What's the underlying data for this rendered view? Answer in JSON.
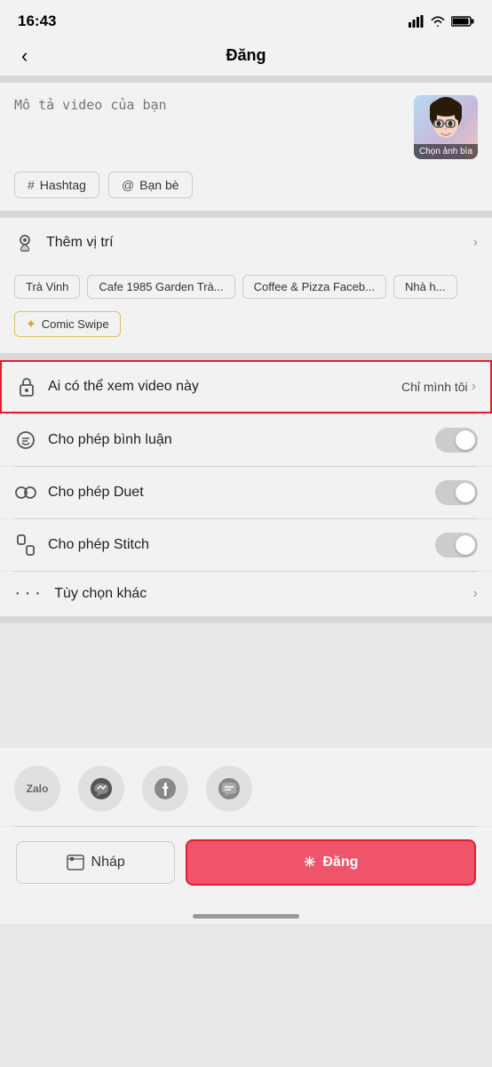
{
  "statusBar": {
    "time": "16:43"
  },
  "header": {
    "back_label": "‹",
    "title": "Đăng"
  },
  "videoSection": {
    "description_placeholder": "Mô tả video của bạn",
    "thumbnail_label": "Chọn ảnh bìa"
  },
  "tags": {
    "hashtag_label": "Hashtag",
    "friends_label": "Bạn bè"
  },
  "location": {
    "add_label": "Thêm vị trí",
    "chips": [
      "Trà Vinh",
      "Cafe 1985 Garden Trà...",
      "Coffee & Pizza Faceb...",
      "Nhà h..."
    ]
  },
  "effect": {
    "label": "Comic Swipe"
  },
  "whoCanView": {
    "label": "Ai có thể xem video này",
    "value": "Chỉ mình tôi"
  },
  "settings": {
    "allow_comment_label": "Cho phép bình luận",
    "allow_duet_label": "Cho phép Duet",
    "allow_stitch_label": "Cho phép Stitch",
    "more_options_label": "Tùy chọn khác"
  },
  "social": {
    "zalo_label": "Zalo"
  },
  "bottomBar": {
    "draft_label": "Nháp",
    "post_label": "Đăng"
  }
}
